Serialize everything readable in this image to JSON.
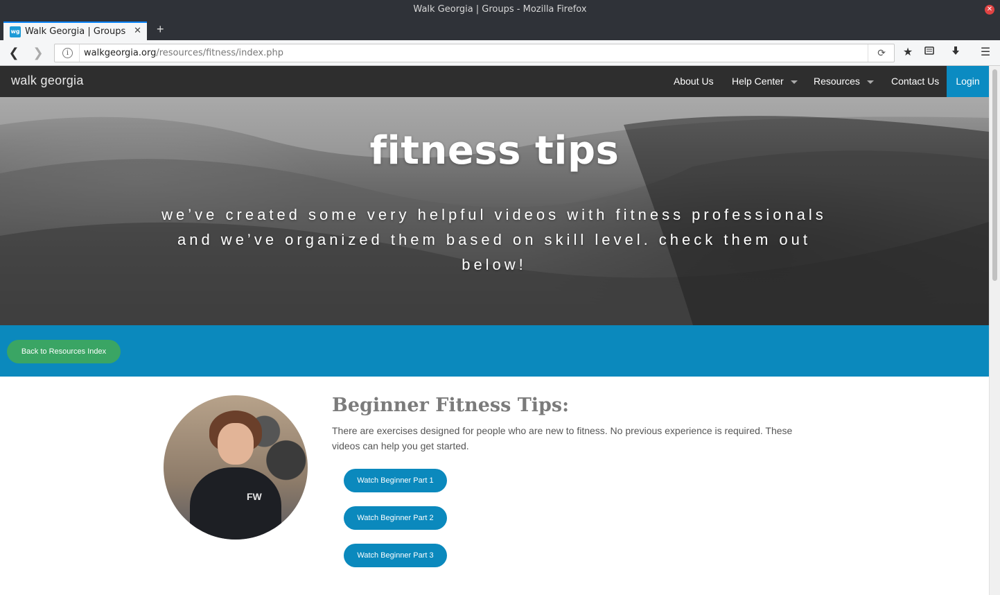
{
  "window": {
    "title": "Walk Georgia | Groups - Mozilla Firefox"
  },
  "tab": {
    "title": "Walk Georgia | Groups",
    "favicon_text": "wg"
  },
  "address": {
    "domain": "walkgeorgia.org",
    "path": "/resources/fitness/index.php"
  },
  "site": {
    "logo": "walk georgia",
    "menu": {
      "about": "About Us",
      "help": "Help Center",
      "resources": "Resources",
      "contact": "Contact Us",
      "login": "Login"
    }
  },
  "hero": {
    "title": "fitness tips",
    "subtitle": "we’ve created some very helpful videos with fitness professionals and we’ve organized them based on skill level. check them out below!"
  },
  "band": {
    "back_button": "Back to Resources Index"
  },
  "beginner": {
    "title": "Beginner Fitness Tips:",
    "description": "There are exercises designed for people who are new to fitness. No previous experience is required. These videos can help you get started.",
    "avatar_logo": "FW",
    "buttons": [
      "Watch Beginner Part 1",
      "Watch Beginner Part 2",
      "Watch Beginner Part 3"
    ]
  },
  "colors": {
    "brand_blue": "#0b89bd",
    "back_green": "#3aa564",
    "header_dark": "#2e2e2e"
  },
  "icons": [
    "back-arrow-icon",
    "forward-arrow-icon",
    "info-icon",
    "reload-icon",
    "bookmark-star-icon",
    "library-icon",
    "download-icon",
    "hamburger-menu-icon",
    "tab-close-icon",
    "new-tab-icon",
    "window-close-icon",
    "dropdown-caret-icon"
  ]
}
